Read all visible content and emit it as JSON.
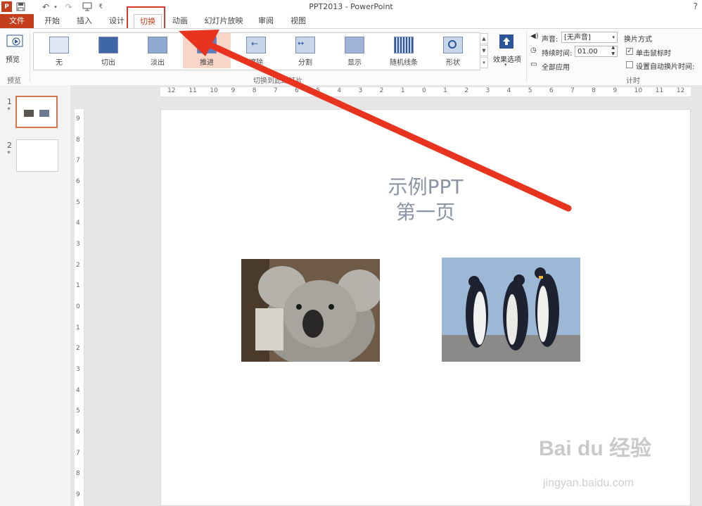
{
  "window": {
    "title": "PPT2013 - PowerPoint",
    "help": "?",
    "logo": "P"
  },
  "quick_access": {
    "save_icon": "save-icon",
    "undo_icon": "undo-icon",
    "redo_icon": "redo-icon",
    "start_icon": "slideshow-start-icon"
  },
  "tabs": [
    {
      "id": "file",
      "label": "文件"
    },
    {
      "id": "home",
      "label": "开始"
    },
    {
      "id": "insert",
      "label": "插入"
    },
    {
      "id": "design",
      "label": "设计"
    },
    {
      "id": "transitions",
      "label": "切换",
      "active": true
    },
    {
      "id": "animations",
      "label": "动画"
    },
    {
      "id": "slideshow",
      "label": "幻灯片放映"
    },
    {
      "id": "review",
      "label": "审阅"
    },
    {
      "id": "view",
      "label": "视图"
    }
  ],
  "ribbon": {
    "preview": {
      "button_label": "预览",
      "group_label": "预览"
    },
    "transitions_group_label": "切换到此幻灯片",
    "transitions": [
      {
        "label": "无"
      },
      {
        "label": "切出"
      },
      {
        "label": "淡出"
      },
      {
        "label": "推进",
        "selected": true
      },
      {
        "label": "擦除"
      },
      {
        "label": "分割"
      },
      {
        "label": "显示"
      },
      {
        "label": "随机线条"
      },
      {
        "label": "形状"
      }
    ],
    "effect_options_label": "效果选项",
    "timing": {
      "group_label": "计时",
      "sound_label": "声音:",
      "sound_value": "[无声音]",
      "duration_label": "持续时间:",
      "duration_value": "01.00",
      "apply_all_label": "全部应用",
      "advance_label": "换片方式",
      "on_click_label": "单击鼠标时",
      "on_click_checked": true,
      "after_label": "设置自动换片时间:",
      "after_checked": false
    }
  },
  "slides": [
    {
      "number": "1",
      "star": "*"
    },
    {
      "number": "2",
      "star": "*"
    }
  ],
  "ruler": {
    "h": [
      "12",
      "11",
      "10",
      "9",
      "8",
      "7",
      "6",
      "5",
      "4",
      "3",
      "2",
      "1",
      "0",
      "1",
      "2",
      "3",
      "4",
      "5",
      "6",
      "7",
      "8",
      "9",
      "10",
      "11",
      "12"
    ],
    "v": [
      "9",
      "8",
      "7",
      "6",
      "5",
      "4",
      "3",
      "2",
      "1",
      "0",
      "1",
      "2",
      "3",
      "4",
      "5",
      "6",
      "7",
      "8",
      "9"
    ]
  },
  "slide": {
    "title_line1": "示例PPT",
    "title_line2": "第一页",
    "images": [
      {
        "name": "koala"
      },
      {
        "name": "penguins"
      }
    ]
  },
  "watermark": {
    "logo": "Bai du 经验",
    "url": "jingyan.baidu.com"
  },
  "colors": {
    "accent": "#c43e1c",
    "annotation": "#e8331f",
    "selected": "#f8d5c6"
  }
}
